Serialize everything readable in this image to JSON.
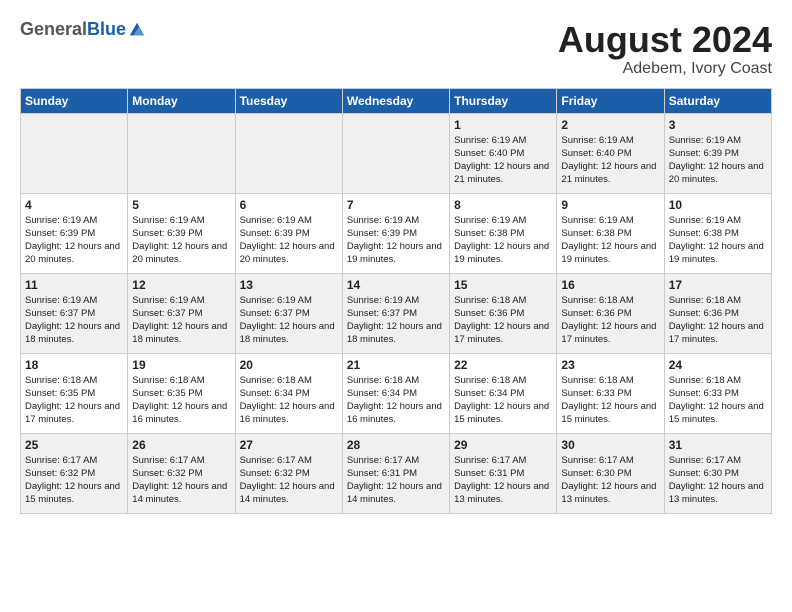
{
  "header": {
    "logo_general": "General",
    "logo_blue": "Blue",
    "main_title": "August 2024",
    "subtitle": "Adebem, Ivory Coast"
  },
  "calendar": {
    "days_of_week": [
      "Sunday",
      "Monday",
      "Tuesday",
      "Wednesday",
      "Thursday",
      "Friday",
      "Saturday"
    ],
    "weeks": [
      [
        {
          "day": "",
          "info": ""
        },
        {
          "day": "",
          "info": ""
        },
        {
          "day": "",
          "info": ""
        },
        {
          "day": "",
          "info": ""
        },
        {
          "day": "1",
          "info": "Sunrise: 6:19 AM\nSunset: 6:40 PM\nDaylight: 12 hours and 21 minutes."
        },
        {
          "day": "2",
          "info": "Sunrise: 6:19 AM\nSunset: 6:40 PM\nDaylight: 12 hours and 21 minutes."
        },
        {
          "day": "3",
          "info": "Sunrise: 6:19 AM\nSunset: 6:39 PM\nDaylight: 12 hours and 20 minutes."
        }
      ],
      [
        {
          "day": "4",
          "info": "Sunrise: 6:19 AM\nSunset: 6:39 PM\nDaylight: 12 hours and 20 minutes."
        },
        {
          "day": "5",
          "info": "Sunrise: 6:19 AM\nSunset: 6:39 PM\nDaylight: 12 hours and 20 minutes."
        },
        {
          "day": "6",
          "info": "Sunrise: 6:19 AM\nSunset: 6:39 PM\nDaylight: 12 hours and 20 minutes."
        },
        {
          "day": "7",
          "info": "Sunrise: 6:19 AM\nSunset: 6:39 PM\nDaylight: 12 hours and 19 minutes."
        },
        {
          "day": "8",
          "info": "Sunrise: 6:19 AM\nSunset: 6:38 PM\nDaylight: 12 hours and 19 minutes."
        },
        {
          "day": "9",
          "info": "Sunrise: 6:19 AM\nSunset: 6:38 PM\nDaylight: 12 hours and 19 minutes."
        },
        {
          "day": "10",
          "info": "Sunrise: 6:19 AM\nSunset: 6:38 PM\nDaylight: 12 hours and 19 minutes."
        }
      ],
      [
        {
          "day": "11",
          "info": "Sunrise: 6:19 AM\nSunset: 6:37 PM\nDaylight: 12 hours and 18 minutes."
        },
        {
          "day": "12",
          "info": "Sunrise: 6:19 AM\nSunset: 6:37 PM\nDaylight: 12 hours and 18 minutes."
        },
        {
          "day": "13",
          "info": "Sunrise: 6:19 AM\nSunset: 6:37 PM\nDaylight: 12 hours and 18 minutes."
        },
        {
          "day": "14",
          "info": "Sunrise: 6:19 AM\nSunset: 6:37 PM\nDaylight: 12 hours and 18 minutes."
        },
        {
          "day": "15",
          "info": "Sunrise: 6:18 AM\nSunset: 6:36 PM\nDaylight: 12 hours and 17 minutes."
        },
        {
          "day": "16",
          "info": "Sunrise: 6:18 AM\nSunset: 6:36 PM\nDaylight: 12 hours and 17 minutes."
        },
        {
          "day": "17",
          "info": "Sunrise: 6:18 AM\nSunset: 6:36 PM\nDaylight: 12 hours and 17 minutes."
        }
      ],
      [
        {
          "day": "18",
          "info": "Sunrise: 6:18 AM\nSunset: 6:35 PM\nDaylight: 12 hours and 17 minutes."
        },
        {
          "day": "19",
          "info": "Sunrise: 6:18 AM\nSunset: 6:35 PM\nDaylight: 12 hours and 16 minutes."
        },
        {
          "day": "20",
          "info": "Sunrise: 6:18 AM\nSunset: 6:34 PM\nDaylight: 12 hours and 16 minutes."
        },
        {
          "day": "21",
          "info": "Sunrise: 6:18 AM\nSunset: 6:34 PM\nDaylight: 12 hours and 16 minutes."
        },
        {
          "day": "22",
          "info": "Sunrise: 6:18 AM\nSunset: 6:34 PM\nDaylight: 12 hours and 15 minutes."
        },
        {
          "day": "23",
          "info": "Sunrise: 6:18 AM\nSunset: 6:33 PM\nDaylight: 12 hours and 15 minutes."
        },
        {
          "day": "24",
          "info": "Sunrise: 6:18 AM\nSunset: 6:33 PM\nDaylight: 12 hours and 15 minutes."
        }
      ],
      [
        {
          "day": "25",
          "info": "Sunrise: 6:17 AM\nSunset: 6:32 PM\nDaylight: 12 hours and 15 minutes."
        },
        {
          "day": "26",
          "info": "Sunrise: 6:17 AM\nSunset: 6:32 PM\nDaylight: 12 hours and 14 minutes."
        },
        {
          "day": "27",
          "info": "Sunrise: 6:17 AM\nSunset: 6:32 PM\nDaylight: 12 hours and 14 minutes."
        },
        {
          "day": "28",
          "info": "Sunrise: 6:17 AM\nSunset: 6:31 PM\nDaylight: 12 hours and 14 minutes."
        },
        {
          "day": "29",
          "info": "Sunrise: 6:17 AM\nSunset: 6:31 PM\nDaylight: 12 hours and 13 minutes."
        },
        {
          "day": "30",
          "info": "Sunrise: 6:17 AM\nSunset: 6:30 PM\nDaylight: 12 hours and 13 minutes."
        },
        {
          "day": "31",
          "info": "Sunrise: 6:17 AM\nSunset: 6:30 PM\nDaylight: 12 hours and 13 minutes."
        }
      ]
    ]
  }
}
